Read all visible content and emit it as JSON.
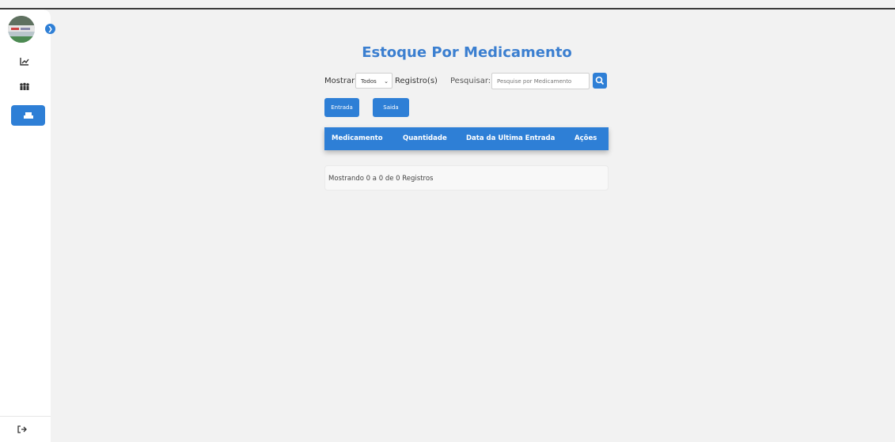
{
  "page": {
    "title": "Estoque Por Medicamento"
  },
  "controls": {
    "show_label": "Mostrar",
    "show_value": "Todos",
    "records_label": "Registro(s)",
    "search_label": "Pesquisar:",
    "search_placeholder": "Pesquise por Medicamento"
  },
  "actions": {
    "entrada": "Entrada",
    "saida": "Saida"
  },
  "table": {
    "headers": [
      "Medicamento",
      "Quantidade",
      "Data da Ultima Entrada",
      "Ações"
    ],
    "rows": []
  },
  "footer": {
    "info": "Mostrando 0 a 0 de 0 Registros"
  },
  "colors": {
    "accent": "#2e7fd6",
    "title": "#3b7fd0",
    "background": "#f2f2f2"
  }
}
